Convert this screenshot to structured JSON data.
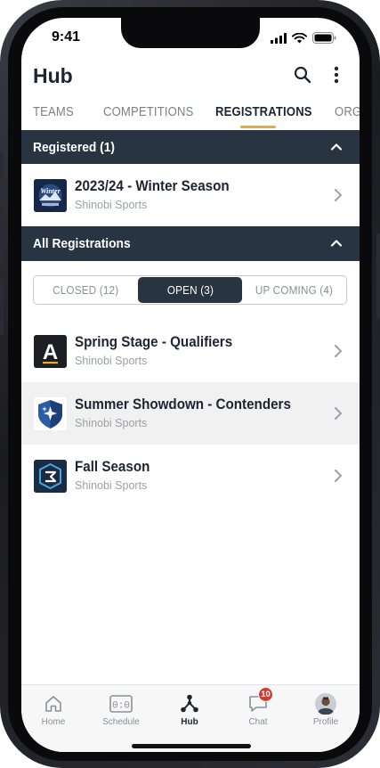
{
  "status_bar": {
    "time": "9:41"
  },
  "header": {
    "title": "Hub"
  },
  "tabs": [
    {
      "label": "TEAMS"
    },
    {
      "label": "COMPETITIONS"
    },
    {
      "label": "REGISTRATIONS"
    },
    {
      "label": "ORGA"
    }
  ],
  "registered_section": {
    "title": "Registered (1)",
    "items": [
      {
        "title": "2023/24 - Winter Season",
        "subtitle": "Shinobi Sports",
        "logo": "winter-logo",
        "logo_text": "Winter"
      }
    ]
  },
  "all_section": {
    "title": "All Registrations",
    "filter": [
      {
        "label": "CLOSED (12)"
      },
      {
        "label": "OPEN (3)"
      },
      {
        "label": "UP COMING (4)"
      }
    ],
    "items": [
      {
        "title": "Spring Stage - Qualifiers",
        "subtitle": "Shinobi Sports",
        "logo": "letter-a-logo",
        "logo_text": "A"
      },
      {
        "title": "Summer Showdown - Contenders",
        "subtitle": "Shinobi Sports",
        "logo": "star-shield-logo"
      },
      {
        "title": "Fall Season",
        "subtitle": "Shinobi Sports",
        "logo": "fall-logo"
      }
    ]
  },
  "bottom_nav": [
    {
      "label": "Home",
      "icon": "home-icon"
    },
    {
      "label": "Schedule",
      "icon": "schedule-icon",
      "icon_text": "0:0"
    },
    {
      "label": "Hub",
      "icon": "hub-icon"
    },
    {
      "label": "Chat",
      "icon": "chat-icon",
      "badge": "10"
    },
    {
      "label": "Profile",
      "icon": "profile-avatar"
    }
  ],
  "colors": {
    "header_bg": "#283441",
    "accent": "#e6a93a",
    "text_primary": "#1c2531",
    "text_muted": "#9aa0a6",
    "badge": "#d83a2e"
  }
}
